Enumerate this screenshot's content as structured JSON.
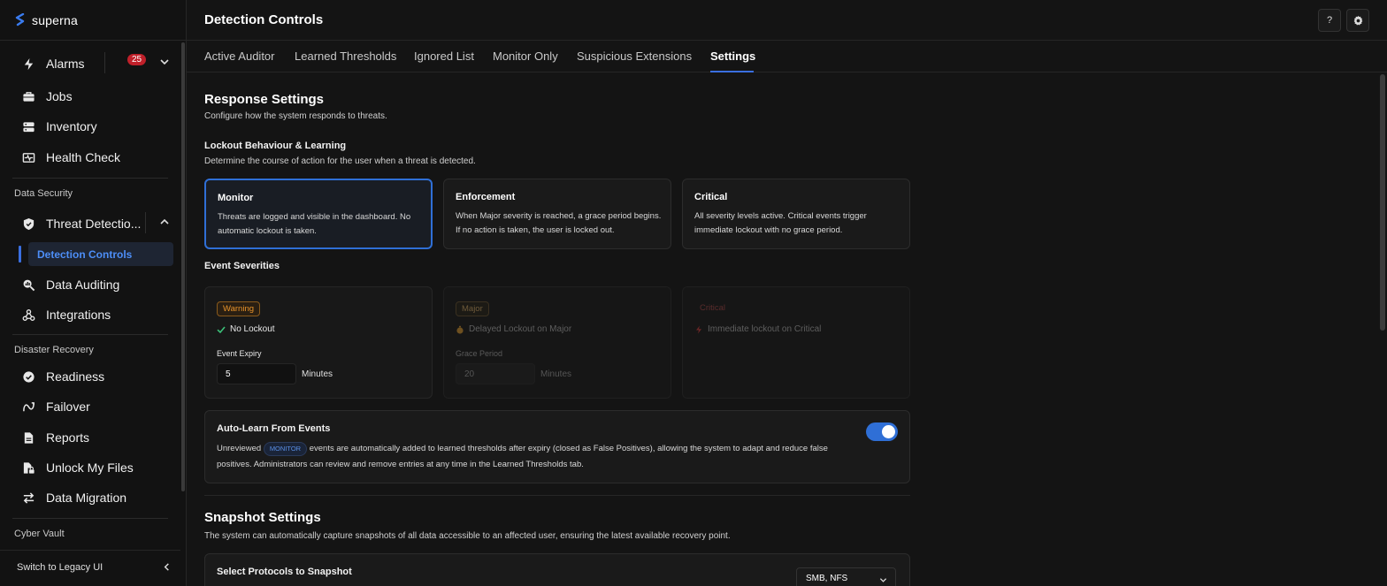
{
  "brand": {
    "name": "superna"
  },
  "sidebar": {
    "top_items": [
      {
        "label": "Alarms",
        "badge": "25"
      },
      {
        "label": "Jobs"
      },
      {
        "label": "Inventory"
      },
      {
        "label": "Health Check"
      }
    ],
    "sections": {
      "data_security": "Data Security",
      "disaster_recovery": "Disaster Recovery",
      "cyber_vault": "Cyber Vault"
    },
    "threat_detection": "Threat Detectio...",
    "detection_controls": "Detection Controls",
    "data_auditing": "Data Auditing",
    "integrations": "Integrations",
    "dr_items": [
      {
        "label": "Readiness"
      },
      {
        "label": "Failover"
      },
      {
        "label": "Reports"
      },
      {
        "label": "Unlock My Files"
      },
      {
        "label": "Data Migration"
      }
    ],
    "legacy": "Switch to Legacy UI"
  },
  "header": {
    "title": "Detection Controls",
    "help": "?"
  },
  "tabs": [
    {
      "label": "Active Auditor"
    },
    {
      "label": "Learned Thresholds"
    },
    {
      "label": "Ignored List"
    },
    {
      "label": "Monitor Only"
    },
    {
      "label": "Suspicious Extensions"
    },
    {
      "label": "Settings",
      "active": true
    }
  ],
  "response": {
    "title": "Response Settings",
    "desc": "Configure how the system responds to threats.",
    "lockout_title": "Lockout Behaviour & Learning",
    "lockout_desc": "Determine the course of action for the user when a threat is detected.",
    "modes": [
      {
        "title": "Monitor",
        "desc": "Threats are logged and visible in the dashboard. No automatic lockout is taken.",
        "selected": true
      },
      {
        "title": "Enforcement",
        "desc": "When Major severity is reached, a grace period begins. If no action is taken, the user is locked out."
      },
      {
        "title": "Critical",
        "desc": "All severity levels active. Critical events trigger immediate lockout with no grace period."
      }
    ],
    "severities_title": "Event Severities",
    "severities": [
      {
        "pill": "Warning",
        "line": "No Lockout",
        "field_label": "Event Expiry",
        "value": "5",
        "unit": "Minutes"
      },
      {
        "pill": "Major",
        "line": "Delayed Lockout on Major",
        "field_label": "Grace Period",
        "value": "20",
        "unit": "Minutes"
      },
      {
        "pill": "Critical",
        "line": "Immediate lockout on Critical"
      }
    ],
    "auto_learn": {
      "title": "Auto-Learn From Events",
      "pre": "Unreviewed",
      "tag": "MONITOR",
      "post": "events are automatically added to learned thresholds after expiry (closed as False Positives), allowing the system to adapt and reduce false positives. Administrators can review and remove entries at any time in the Learned Thresholds tab.",
      "enabled": true
    }
  },
  "snapshot": {
    "title": "Snapshot Settings",
    "desc": "The system can automatically capture snapshots of all data accessible to an affected user, ensuring the latest available recovery point.",
    "protocols_title": "Select Protocols to Snapshot",
    "protocols_value": "SMB, NFS"
  },
  "colors": {
    "accent": "#2f6fd6",
    "badge": "#c0202a",
    "warning": "#e8932a"
  }
}
